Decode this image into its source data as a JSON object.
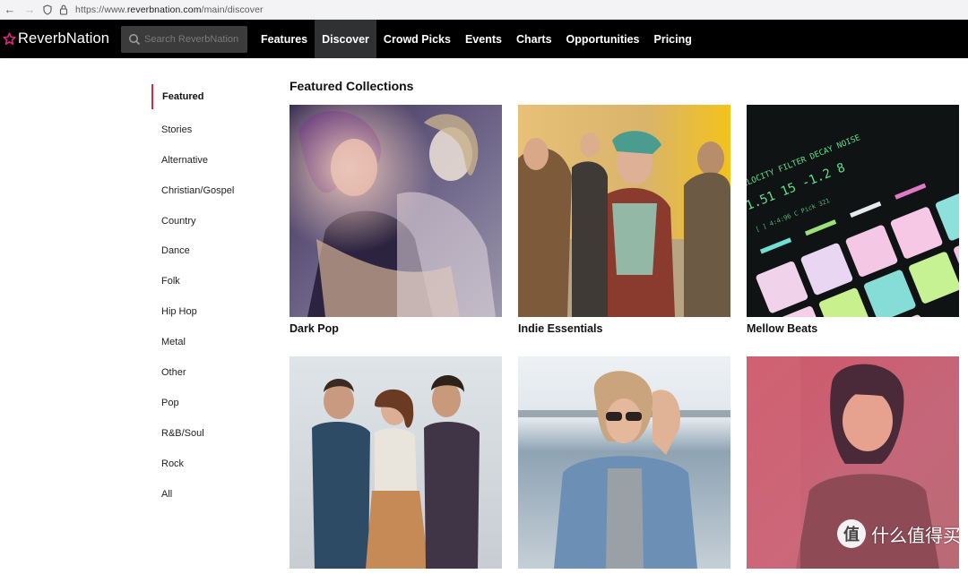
{
  "browser": {
    "url_scheme": "https://www.",
    "url_host": "reverbnation.com",
    "url_path": "/main/discover"
  },
  "header": {
    "logo_text": "ReverbNation",
    "search_placeholder": "Search ReverbNation",
    "nav": [
      {
        "label": "Features",
        "active": false
      },
      {
        "label": "Discover",
        "active": true
      },
      {
        "label": "Crowd Picks",
        "active": false
      },
      {
        "label": "Events",
        "active": false
      },
      {
        "label": "Charts",
        "active": false
      },
      {
        "label": "Opportunities",
        "active": false
      },
      {
        "label": "Pricing",
        "active": false
      }
    ]
  },
  "sidebar": {
    "items": [
      {
        "label": "Featured",
        "active": true
      },
      {
        "label": "Stories"
      },
      {
        "label": "Alternative"
      },
      {
        "label": "Christian/Gospel"
      },
      {
        "label": "Country"
      },
      {
        "label": "Dance"
      },
      {
        "label": "Folk"
      },
      {
        "label": "Hip Hop"
      },
      {
        "label": "Metal"
      },
      {
        "label": "Other"
      },
      {
        "label": "Pop"
      },
      {
        "label": "R&B/Soul"
      },
      {
        "label": "Rock"
      },
      {
        "label": "All"
      }
    ]
  },
  "main": {
    "section_title": "Featured Collections",
    "collections": [
      {
        "caption": "Dark Pop"
      },
      {
        "caption": "Indie Essentials"
      },
      {
        "caption": "Mellow Beats"
      },
      {
        "caption": ""
      },
      {
        "caption": ""
      },
      {
        "caption": ""
      }
    ]
  },
  "watermark": {
    "glyph": "值",
    "text": "什么值得买"
  },
  "colors": {
    "header_bg": "#000000",
    "active_nav_bg": "#2f3133",
    "accent_red": "#e0263e",
    "logo_star": "#e0267a"
  }
}
